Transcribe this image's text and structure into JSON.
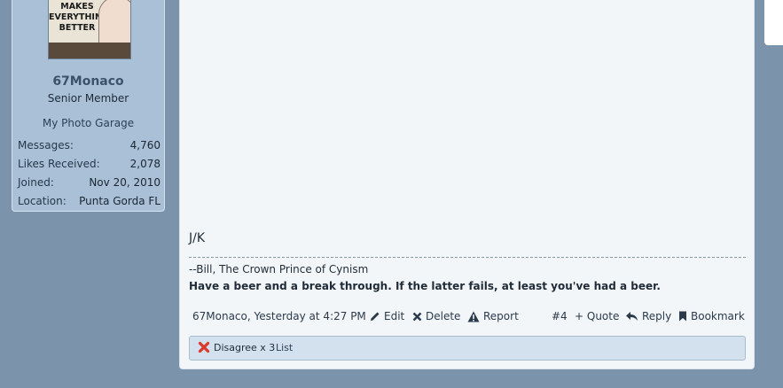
{
  "avatar": {
    "caption": "MAKES\nEVERYTHING\nBETTER"
  },
  "user": {
    "name": "67Monaco",
    "title": "Senior Member",
    "garage_link": "My Photo Garage",
    "stats": [
      {
        "label": "Messages:",
        "value": "4,760"
      },
      {
        "label": "Likes Received:",
        "value": "2,078"
      },
      {
        "label": "Joined:",
        "value": "Nov 20, 2010"
      },
      {
        "label": "Location:",
        "value": "Punta Gorda FL"
      }
    ]
  },
  "post": {
    "text": "J/K",
    "signature": {
      "line1": "--Bill, The Crown Prince of Cynism",
      "line2": "Have a beer and a break through. If the latter fails, at least you've had a beer."
    },
    "footer": {
      "author_time": "67Monaco, Yesterday at 4:27 PM",
      "edit": "Edit",
      "delete": "Delete",
      "report": "Report",
      "post_number": "#4",
      "quote": "+ Quote",
      "reply": "Reply",
      "bookmark": "Bookmark"
    },
    "reactions": {
      "summary": "Disagree x 3",
      "list": "List"
    }
  },
  "icons": [
    "pencil-icon",
    "x-icon",
    "warning-icon",
    "reply-icon",
    "bookmark-icon",
    "disagree-icon"
  ]
}
